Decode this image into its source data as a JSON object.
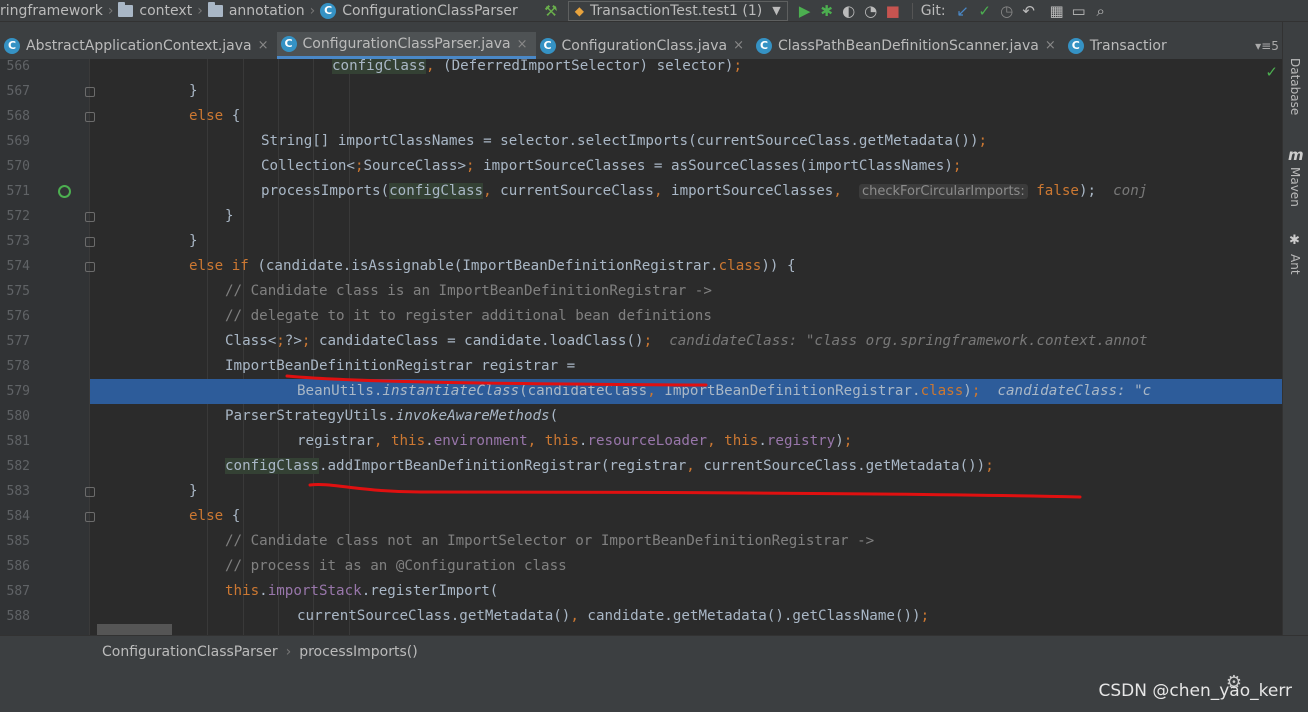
{
  "navbar": {
    "crumbs": [
      "ringframework",
      "context",
      "annotation",
      "ConfigurationClassParser"
    ],
    "run_config": "TransactionTest.test1 (1)",
    "git_label": "Git:"
  },
  "tabs": [
    {
      "label": "AbstractApplicationContext.java",
      "active": false
    },
    {
      "label": "ConfigurationClassParser.java",
      "active": true
    },
    {
      "label": "ConfigurationClass.java",
      "active": false
    },
    {
      "label": "ClassPathBeanDefinitionScanner.java",
      "active": false
    },
    {
      "label": "Transactior",
      "active": false
    }
  ],
  "tab_more": "▾≡5",
  "right_sidebar": {
    "database": "Database",
    "maven": "Maven",
    "ant": "Ant"
  },
  "lines": [
    {
      "num": "566",
      "text": "configClass, (DeferredImportSelector) selector);"
    },
    {
      "num": "567",
      "text": "}"
    },
    {
      "num": "568",
      "text": "else {"
    },
    {
      "num": "569",
      "text": "String[] importClassNames = selector.selectImports(currentSourceClass.getMetadata());"
    },
    {
      "num": "570",
      "text": "Collection<SourceClass> importSourceClasses = asSourceClasses(importClassNames);"
    },
    {
      "num": "571",
      "text": "processImports(configClass, currentSourceClass, importSourceClasses,"
    },
    {
      "num": "572",
      "text": "}"
    },
    {
      "num": "573",
      "text": "}"
    },
    {
      "num": "574",
      "text": "else if (candidate.isAssignable(ImportBeanDefinitionRegistrar.class)) {"
    },
    {
      "num": "575",
      "text": "// Candidate class is an ImportBeanDefinitionRegistrar ->"
    },
    {
      "num": "576",
      "text": "// delegate to it to register additional bean definitions"
    },
    {
      "num": "577",
      "text": "Class<?> candidateClass = candidate.loadClass();"
    },
    {
      "num": "578",
      "text": "ImportBeanDefinitionRegistrar registrar ="
    },
    {
      "num": "579",
      "text": "BeanUtils.instantiateClass(candidateClass, ImportBeanDefinitionRegistrar.class);"
    },
    {
      "num": "580",
      "text": "ParserStrategyUtils.invokeAwareMethods("
    },
    {
      "num": "581",
      "text": "registrar, this.environment, this.resourceLoader, this.registry);"
    },
    {
      "num": "582",
      "text": "configClass.addImportBeanDefinitionRegistrar(registrar, currentSourceClass.getMetadata());"
    },
    {
      "num": "583",
      "text": "}"
    },
    {
      "num": "584",
      "text": "else {"
    },
    {
      "num": "585",
      "text": "// Candidate class not an ImportSelector or ImportBeanDefinitionRegistrar ->"
    },
    {
      "num": "586",
      "text": "// process it as an @Configuration class"
    },
    {
      "num": "587",
      "text": "this.importStack.registerImport("
    },
    {
      "num": "588",
      "text": "currentSourceClass.getMetadata(), candidate.getMetadata().getClassName());"
    }
  ],
  "inlay": {
    "param_hint": "checkForCircularImports:",
    "param_value": "false);",
    "hint_tail": "conj",
    "debug_577": "candidateClass: \"class org.springframework.context.annot",
    "debug_579": "candidateClass: \"c"
  },
  "status": {
    "crumb1": "ConfigurationClassParser",
    "crumb2": "processImports()"
  },
  "watermark": "CSDN @chen_yao_kerr",
  "colors": {
    "keyword": "#cc7832",
    "comment": "#808080",
    "selection": "#2d5c9a",
    "annotation_line": "#e01010"
  }
}
